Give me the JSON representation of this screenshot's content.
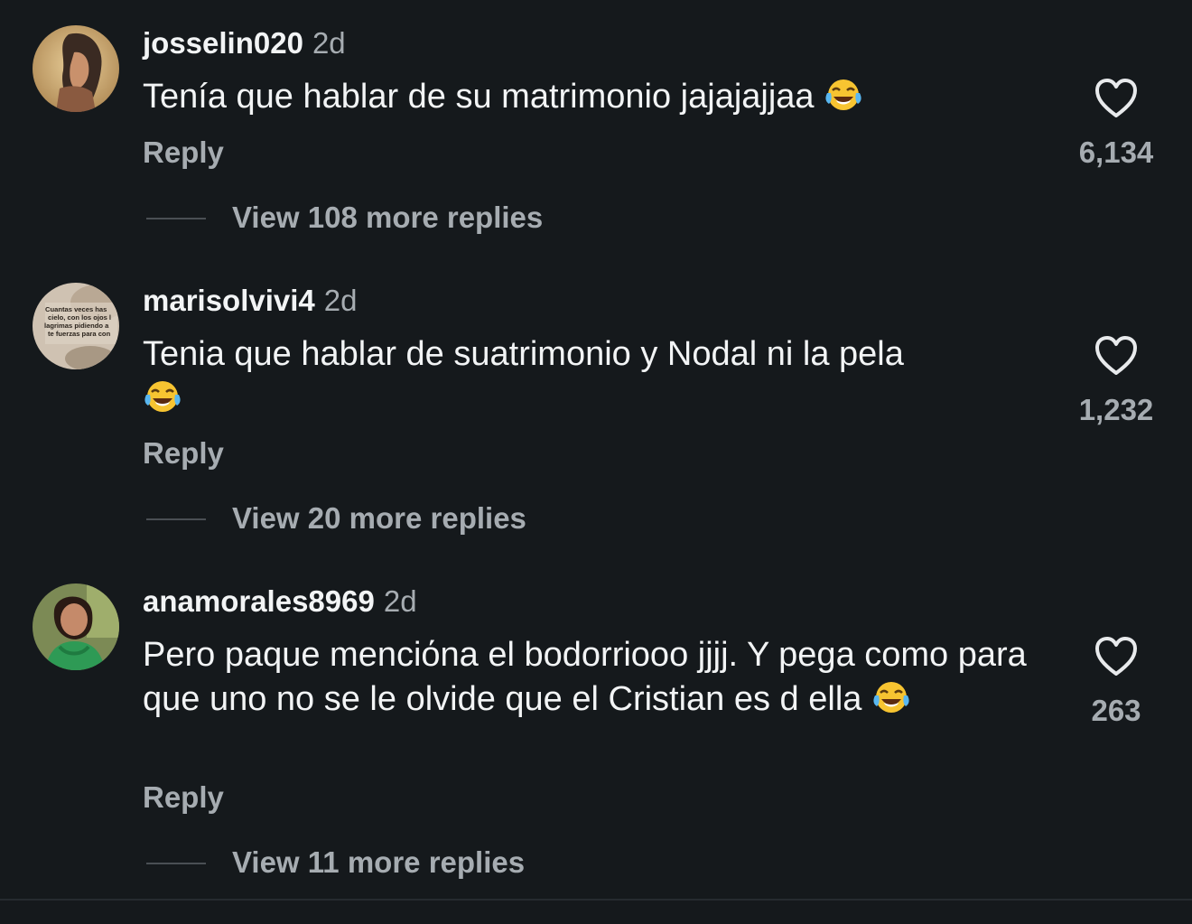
{
  "comments": [
    {
      "username": "josselin020",
      "age": "2d",
      "text": "Tenía que hablar de su matrimonio jajajajjaa",
      "emoji": "face-with-tears-of-joy",
      "reply_label": "Reply",
      "likes": "6,134",
      "view_more": "View 108 more replies"
    },
    {
      "username": "marisolvivi4",
      "age": "2d",
      "text": "Tenia que hablar de suatrimonio y Nodal ni la pela",
      "emoji": "face-with-tears-of-joy",
      "reply_label": "Reply",
      "likes": "1,232",
      "view_more": "View 20 more replies",
      "avatar_text": [
        "Cuantas veces has",
        "cielo, con los ojos l",
        "lagrimas pidiendo a",
        "te fuerzas para con"
      ]
    },
    {
      "username": "anamorales8969",
      "age": "2d",
      "text": "Pero paque menciόna el bodorriooo jjjj. Y pega como para que uno no se le olvide que el Cristian es d ella",
      "emoji": "face-with-tears-of-joy",
      "reply_label": "Reply",
      "likes": "263",
      "view_more": "View 11 more replies"
    }
  ],
  "colors": {
    "background": "#15191c",
    "primary_text": "#f2f4f5",
    "secondary_text": "#a6acb1"
  }
}
